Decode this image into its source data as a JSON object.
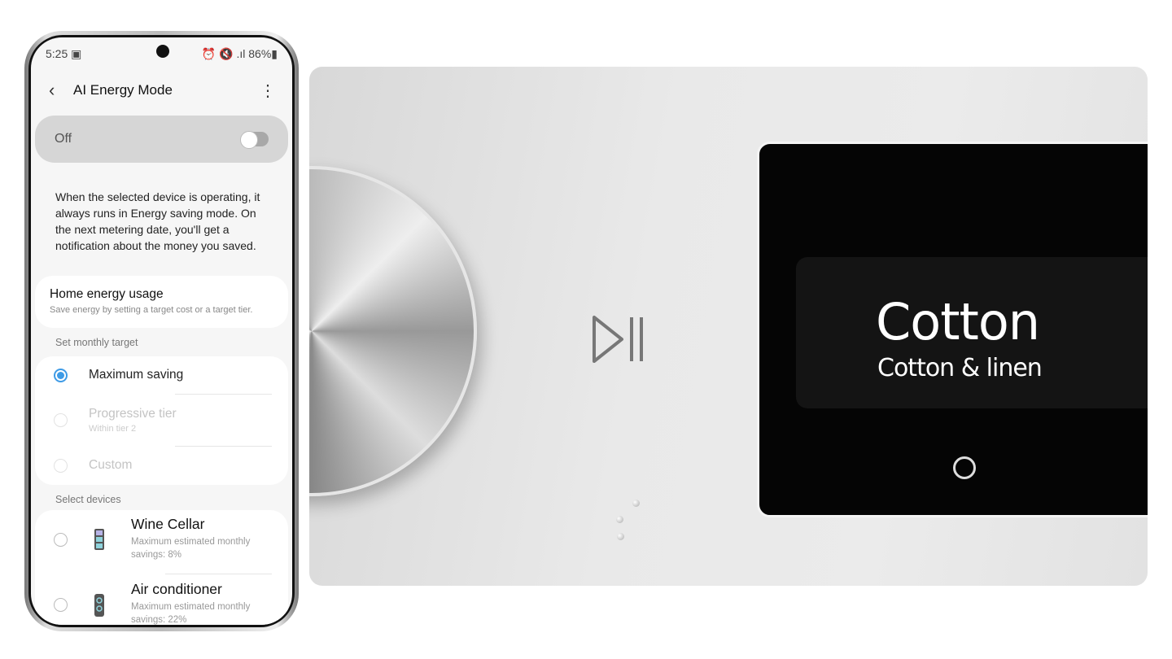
{
  "phone": {
    "status": {
      "time": "5:25",
      "battery": "86%",
      "icons": [
        "gallery-icon",
        "alarm-icon",
        "mute-icon",
        "wifi-icon",
        "signal-icon",
        "battery-icon"
      ]
    },
    "appbar": {
      "title": "AI Energy Mode",
      "back_icon": "back-chevron-icon",
      "more_icon": "more-vertical-icon"
    },
    "master_switch": {
      "label": "Off",
      "on": false
    },
    "description": "When the selected device is operating, it always runs in Energy saving mode. On the next metering date, you'll get a notification about the money you saved.",
    "home_energy": {
      "title": "Home energy usage",
      "subtitle": "Save energy by setting a target cost or a target tier."
    },
    "target_section": "Set monthly target",
    "targets": [
      {
        "label": "Maximum saving",
        "selected": true,
        "enabled": true
      },
      {
        "label": "Progressive tier",
        "sub": "Within tier 2",
        "selected": false,
        "enabled": false
      },
      {
        "label": "Custom",
        "selected": false,
        "enabled": false
      }
    ],
    "devices_section": "Select devices",
    "devices": [
      {
        "name": "Wine Cellar",
        "line1": "Maximum estimated monthly",
        "line2": "savings: 8%",
        "icon": "wine-cellar-icon"
      },
      {
        "name": "Air conditioner",
        "line1": "Maximum estimated monthly",
        "line2": "savings: 22%",
        "icon": "air-conditioner-icon"
      }
    ]
  },
  "appliance": {
    "program": "Cotton",
    "program_sub": "Cotton & linen",
    "play_pause_icon": "play-pause-icon"
  }
}
